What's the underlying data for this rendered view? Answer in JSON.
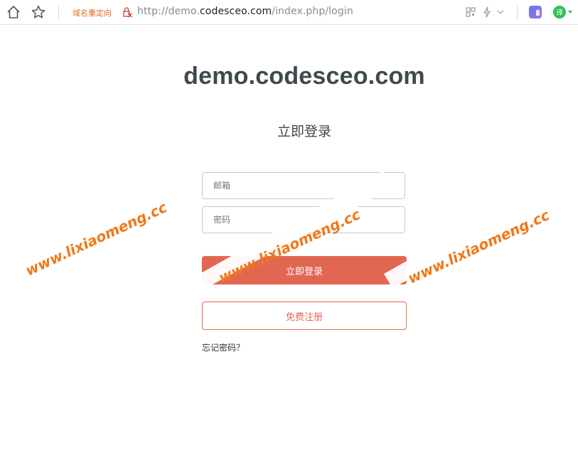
{
  "browser": {
    "redirect_label": "域名重定向",
    "url_prefix": "http://demo.",
    "url_domain": "codesceo.com",
    "url_path": "/index.php/login",
    "translate_label": "译"
  },
  "login": {
    "site_title": "demo.codesceo.com",
    "heading": "立即登录",
    "email_placeholder": "邮箱",
    "password_placeholder": "密码",
    "login_label": "立即登录",
    "register_label": "免费注册",
    "forgot_label": "忘记密码？"
  },
  "watermark": {
    "text": "www.lixiaomeng.cc",
    "color": "#f07818"
  },
  "colors": {
    "accent": "#e16753",
    "title": "#3e4a4d",
    "redirect": "#e06a1c",
    "translate_badge": "#2fbf55"
  }
}
